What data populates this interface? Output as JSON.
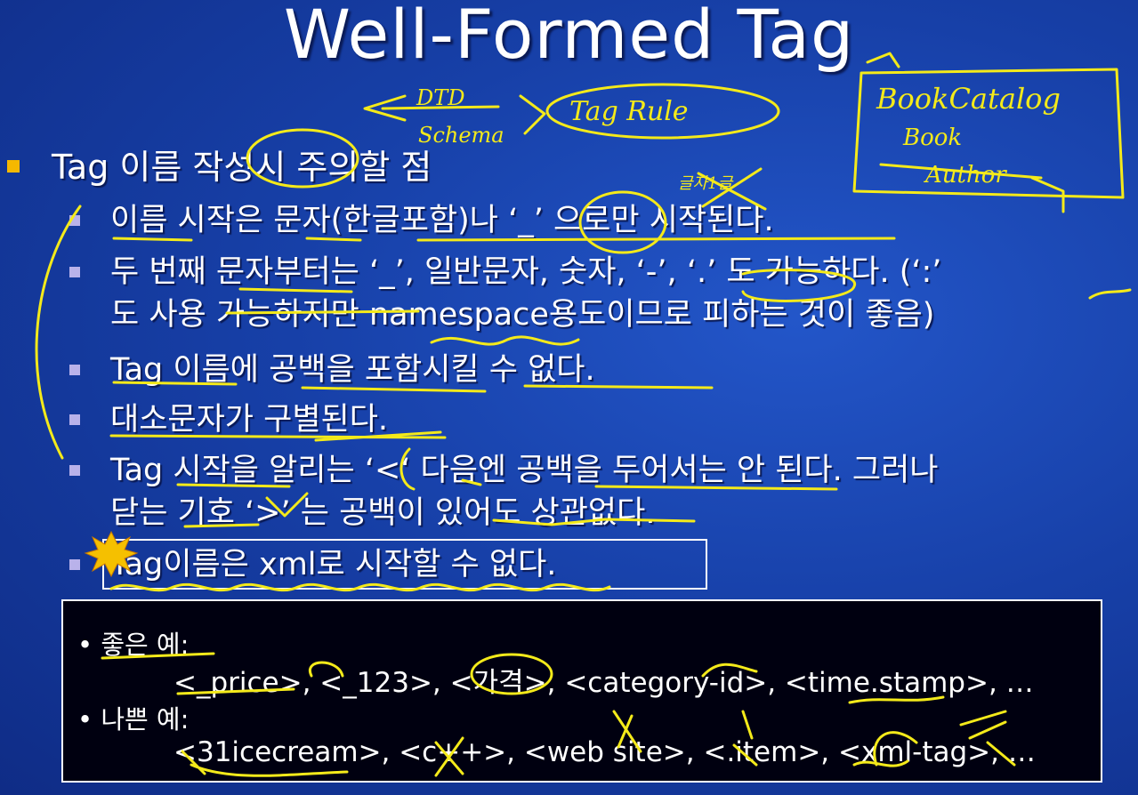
{
  "slide": {
    "title": "Well-Formed Tag",
    "main_bullet": "Tag 이름 작성시 주의할 점",
    "sub_bullets": [
      "이름 시작은 문자(한글포함)나 ‘_’ 으로만 시작된다.",
      "두 번째 문자부터는 ‘_’, 일반문자, 숫자, ‘-’, ‘.’ 도 가능하다. (‘:’\n도 사용 가능하지만 namespace용도이므로 피하는 것이 좋음)",
      "Tag 이름에 공백을 포함시킬 수 없다.",
      "대소문자가 구별된다.",
      "Tag 시작을 알리는 ‘<‘ 다음엔 공백을 두어서는 안 된다. 그러나\n닫는 기호 ‘>’ 는 공백이 있어도 상관없다.",
      "Tag이름은 xml로 시작할 수 없다."
    ],
    "examples": {
      "good_label": "• 좋은 예:",
      "good_line": "<_price>, <_123>, <가격>, <category-id>, <time.stamp>, …",
      "bad_label": "• 나쁜 예:",
      "bad_line": "<31icecream>, <c++>, <web site>, <.item>, <xml-tag>, …"
    }
  },
  "annotations": {
    "dtd": "DTD",
    "schema": "Schema",
    "tag_rule": "Tag Rule",
    "book_catalog": "BookCatalog",
    "book": "Book",
    "author": "Author",
    "unclear_note": "글자1글"
  },
  "colors": {
    "background": "#1740a8",
    "text": "#ffffff",
    "main_bullet": "#f5b800",
    "sub_bullet": "#b9b2ea",
    "ink": "#f4ea1a",
    "example_bg": "#000010"
  }
}
